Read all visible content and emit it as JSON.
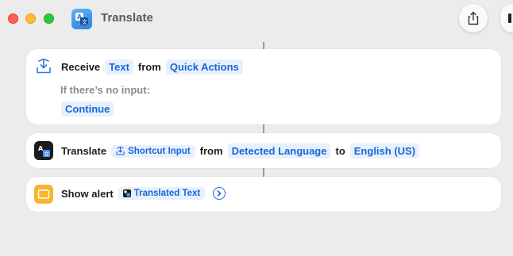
{
  "window": {
    "title": "Translate"
  },
  "steps": {
    "receive": {
      "label": "Receive",
      "type_token": "Text",
      "from_label": "from",
      "source_token": "Quick Actions",
      "no_input_label": "If there’s no input:",
      "no_input_token": "Continue"
    },
    "translate": {
      "label": "Translate",
      "input_token": "Shortcut Input",
      "from_label": "from",
      "from_token": "Detected Language",
      "to_label": "to",
      "to_token": "English (US)"
    },
    "alert": {
      "label": "Show alert",
      "var_token": "Translated Text"
    }
  },
  "colors": {
    "accent": "#1668d9",
    "token_bg": "#e8f0fc",
    "alert_icon": "#f7b52c",
    "translate_icon": "#1c1c1e"
  },
  "icons": {
    "share": "share-icon",
    "receive": "receive-tray-icon",
    "translate": "translate-icon",
    "alert": "alert-window-icon"
  }
}
